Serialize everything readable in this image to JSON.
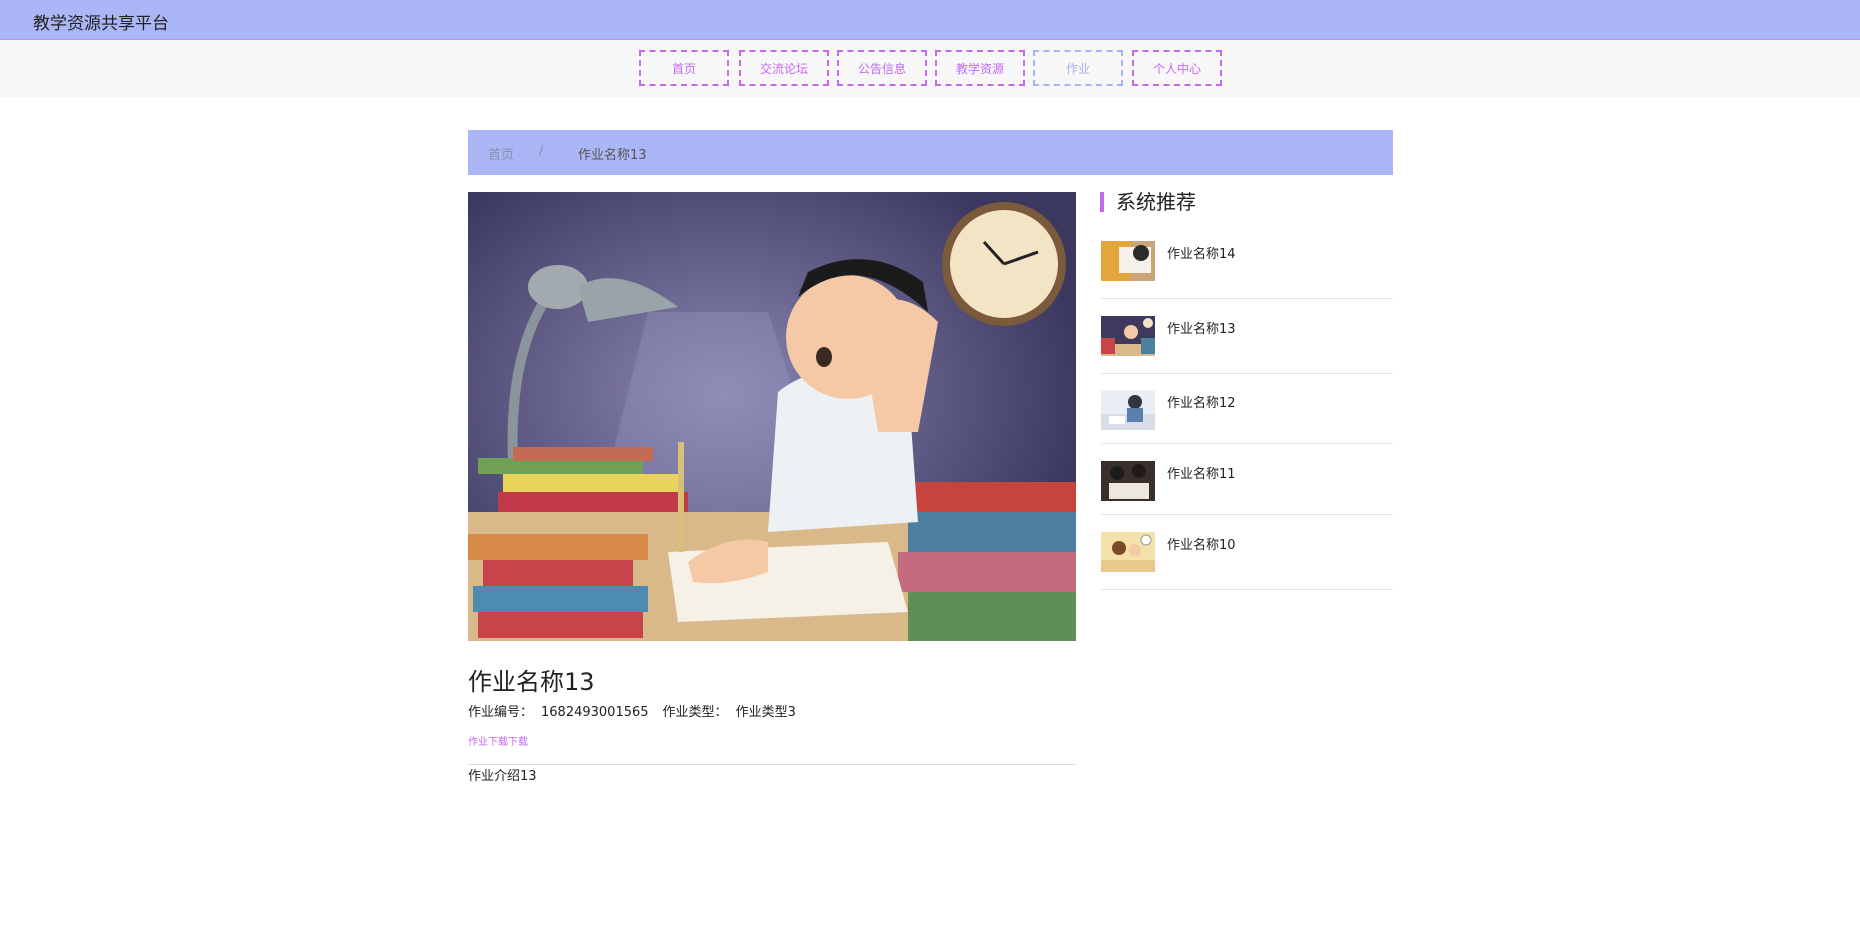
{
  "site": {
    "title": "教学资源共享平台"
  },
  "nav": {
    "items": [
      {
        "label": "首页"
      },
      {
        "label": "交流论坛"
      },
      {
        "label": "公告信息"
      },
      {
        "label": "教学资源"
      },
      {
        "label": "作业"
      },
      {
        "label": "个人中心"
      }
    ],
    "active_index": 4
  },
  "breadcrumb": {
    "home": "首页",
    "separator": "/",
    "current": "作业名称13"
  },
  "detail": {
    "title": "作业名称13",
    "number_label": "作业编号：",
    "number_value": "1682493001565",
    "type_label": "作业类型：",
    "type_value": "作业类型3",
    "download": "作业下载下载",
    "intro": "作业介绍13"
  },
  "sidebar": {
    "title": "系统推荐",
    "items": [
      {
        "name": "作业名称14"
      },
      {
        "name": "作业名称13"
      },
      {
        "name": "作业名称12"
      },
      {
        "name": "作业名称11"
      },
      {
        "name": "作业名称10"
      }
    ]
  },
  "colors": {
    "accent": "#c26af0",
    "header_bg": "#aab6f5",
    "nav_active": "#a7b3f2"
  }
}
